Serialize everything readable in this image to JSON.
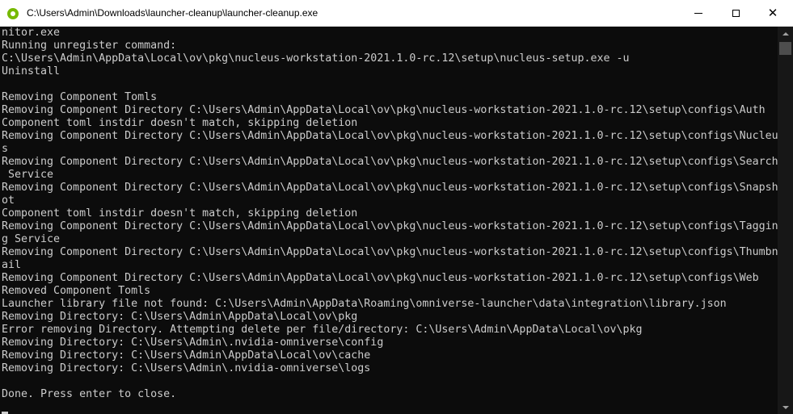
{
  "window": {
    "title": "C:\\Users\\Admin\\Downloads\\launcher-cleanup\\launcher-cleanup.exe",
    "controls": {
      "minimize": "minimize-icon",
      "maximize": "maximize-icon",
      "close": "✕"
    }
  },
  "console": {
    "lines": [
      "nitor.exe",
      "Running unregister command:",
      "C:\\Users\\Admin\\AppData\\Local\\ov\\pkg\\nucleus-workstation-2021.1.0-rc.12\\setup\\nucleus-setup.exe -u",
      "Uninstall",
      "",
      "Removing Component Tomls",
      "Removing Component Directory C:\\Users\\Admin\\AppData\\Local\\ov\\pkg\\nucleus-workstation-2021.1.0-rc.12\\setup\\configs\\Auth",
      "Component toml instdir doesn't match, skipping deletion",
      "Removing Component Directory C:\\Users\\Admin\\AppData\\Local\\ov\\pkg\\nucleus-workstation-2021.1.0-rc.12\\setup\\configs\\Nucleu",
      "s",
      "Removing Component Directory C:\\Users\\Admin\\AppData\\Local\\ov\\pkg\\nucleus-workstation-2021.1.0-rc.12\\setup\\configs\\Search",
      " Service",
      "Removing Component Directory C:\\Users\\Admin\\AppData\\Local\\ov\\pkg\\nucleus-workstation-2021.1.0-rc.12\\setup\\configs\\Snapsh",
      "ot",
      "Component toml instdir doesn't match, skipping deletion",
      "Removing Component Directory C:\\Users\\Admin\\AppData\\Local\\ov\\pkg\\nucleus-workstation-2021.1.0-rc.12\\setup\\configs\\Taggin",
      "g Service",
      "Removing Component Directory C:\\Users\\Admin\\AppData\\Local\\ov\\pkg\\nucleus-workstation-2021.1.0-rc.12\\setup\\configs\\Thumbn",
      "ail",
      "Removing Component Directory C:\\Users\\Admin\\AppData\\Local\\ov\\pkg\\nucleus-workstation-2021.1.0-rc.12\\setup\\configs\\Web",
      "Removed Component Tomls",
      "Launcher library file not found: C:\\Users\\Admin\\AppData\\Roaming\\omniverse-launcher\\data\\integration\\library.json",
      "Removing Directory: C:\\Users\\Admin\\AppData\\Local\\ov\\pkg",
      "Error removing Directory. Attempting delete per file/directory: C:\\Users\\Admin\\AppData\\Local\\ov\\pkg",
      "Removing Directory: C:\\Users\\Admin\\.nvidia-omniverse\\config",
      "Removing Directory: C:\\Users\\Admin\\AppData\\Local\\ov\\cache",
      "Removing Directory: C:\\Users\\Admin\\.nvidia-omniverse\\logs",
      "",
      "Done. Press enter to close."
    ]
  },
  "colors": {
    "console_background": "#0c0c0c",
    "console_text": "#cccccc",
    "titlebar_background": "#ffffff",
    "app_icon": "#76b900"
  }
}
